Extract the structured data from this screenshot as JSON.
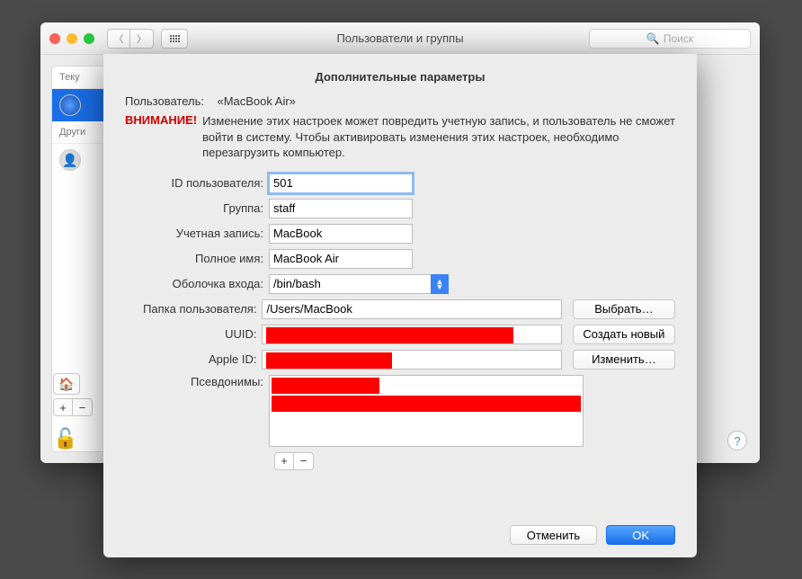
{
  "window": {
    "title": "Пользователи и группы",
    "search_placeholder": "Поиск"
  },
  "sidebar": {
    "header": "Теку",
    "other_header": "Други",
    "guest_glyph": "👤"
  },
  "bottom": {
    "home": "🏠",
    "lock": "🔓"
  },
  "dialog": {
    "title": "Дополнительные параметры",
    "user_label": "Пользователь:",
    "user_value": "«MacBook Air»",
    "warn_label": "ВНИМАНИЕ!",
    "warn_text": "Изменение этих настроек может повредить учетную запись, и пользователь не сможет войти в систему. Чтобы активировать изменения этих настроек, необходимо перезагрузить компьютер.",
    "fields": {
      "uid_label": "ID пользователя:",
      "uid_value": "501",
      "group_label": "Группа:",
      "group_value": "staff",
      "account_label": "Учетная запись:",
      "account_value": "MacBook",
      "fullname_label": "Полное имя:",
      "fullname_value": "MacBook Air",
      "shell_label": "Оболочка входа:",
      "shell_value": "/bin/bash",
      "homedir_label": "Папка пользователя:",
      "homedir_value": "/Users/MacBook",
      "uuid_label": "UUID:",
      "appleid_label": "Apple ID:",
      "aliases_label": "Псевдонимы:"
    },
    "buttons": {
      "choose": "Выбрать…",
      "create": "Создать новый",
      "change": "Изменить…",
      "cancel": "Отменить",
      "ok": "OK"
    }
  }
}
